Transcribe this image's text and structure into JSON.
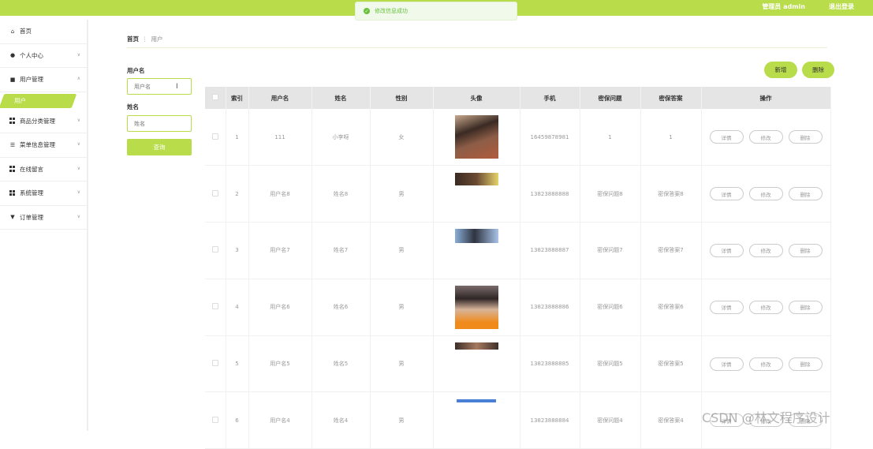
{
  "topbar": {
    "admin_label": "管理员 admin",
    "logout_label": "退出登录"
  },
  "toast": {
    "message": "修改信息成功"
  },
  "sidebar": {
    "items": [
      {
        "label": "首页",
        "icon": "home-icon"
      },
      {
        "label": "个人中心",
        "icon": "user-icon"
      },
      {
        "label": "用户管理",
        "icon": "briefcase-icon",
        "expanded": true
      },
      {
        "label": "商品分类管理",
        "icon": "grid-icon"
      },
      {
        "label": "菜单信息管理",
        "icon": "sliders-icon"
      },
      {
        "label": "在线留言",
        "icon": "grid-icon"
      },
      {
        "label": "系统管理",
        "icon": "grid-icon"
      },
      {
        "label": "订单管理",
        "icon": "badge-icon"
      }
    ],
    "active_sub": "用户"
  },
  "breadcrumb": {
    "home": "首页",
    "current": "用户"
  },
  "filters": {
    "username_label": "用户名",
    "username_placeholder": "用户名",
    "name_label": "姓名",
    "name_placeholder": "姓名",
    "search_label": "查询"
  },
  "actions": {
    "add_label": "新增",
    "delete_label": "删除"
  },
  "table": {
    "headers": [
      "",
      "索引",
      "用户名",
      "姓名",
      "性别",
      "头像",
      "手机",
      "密保问题",
      "密保答案",
      "操作"
    ],
    "rows": [
      {
        "index": "1",
        "username": "111",
        "name": "小李呀",
        "gender": "女",
        "phone": "16459878981",
        "question": "1",
        "answer": "1"
      },
      {
        "index": "2",
        "username": "用户名8",
        "name": "姓名8",
        "gender": "男",
        "phone": "13823888888",
        "question": "密保问题8",
        "answer": "密保答案8"
      },
      {
        "index": "3",
        "username": "用户名7",
        "name": "姓名7",
        "gender": "男",
        "phone": "13823888887",
        "question": "密保问题7",
        "answer": "密保答案7"
      },
      {
        "index": "4",
        "username": "用户名6",
        "name": "姓名6",
        "gender": "男",
        "phone": "13823888886",
        "question": "密保问题6",
        "answer": "密保答案6"
      },
      {
        "index": "5",
        "username": "用户名5",
        "name": "姓名5",
        "gender": "男",
        "phone": "13823888885",
        "question": "密保问题5",
        "answer": "密保答案5"
      },
      {
        "index": "6",
        "username": "用户名4",
        "name": "姓名4",
        "gender": "男",
        "phone": "13823888884",
        "question": "密保问题4",
        "answer": "密保答案4"
      }
    ],
    "op_labels": {
      "detail": "详情",
      "edit": "修改",
      "delete": "删除"
    }
  },
  "watermark": "CSDN @林文程序设计",
  "colors": {
    "accent": "#b8dc4a",
    "success": "#67c23a"
  }
}
